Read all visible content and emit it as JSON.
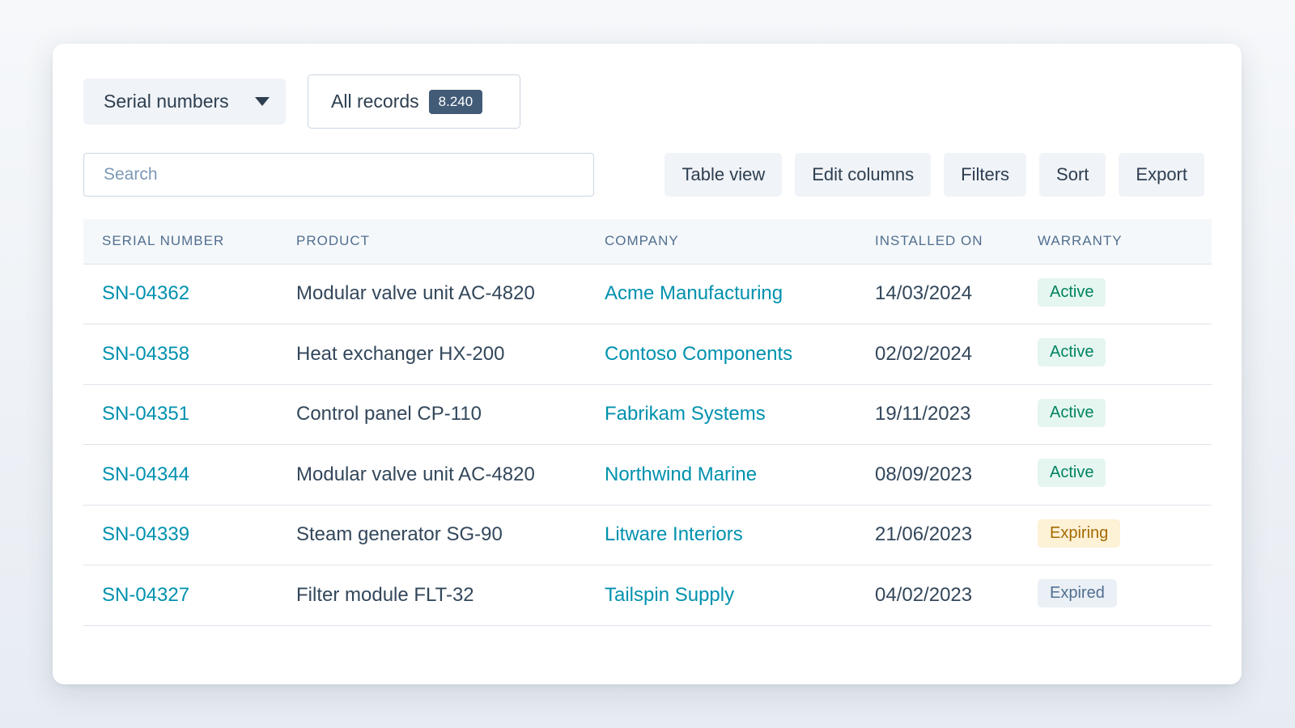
{
  "header": {
    "object_select": {
      "label": "Serial numbers"
    },
    "view_tab": {
      "label": "All records",
      "count": "8.240"
    }
  },
  "search": {
    "placeholder": "Search",
    "value": ""
  },
  "toolbar": {
    "table_view": "Table view",
    "edit_columns": "Edit columns",
    "filters": "Filters",
    "sort": "Sort",
    "export": "Export"
  },
  "table": {
    "columns": [
      "SERIAL NUMBER",
      "PRODUCT",
      "COMPANY",
      "INSTALLED ON",
      "WARRANTY"
    ],
    "rows": [
      {
        "serial": "SN-04362",
        "product": "Modular valve unit AC-4820",
        "company": "Acme Manufacturing",
        "installed": "14/03/2024",
        "warranty": "Active",
        "status": "active"
      },
      {
        "serial": "SN-04358",
        "product": "Heat exchanger HX-200",
        "company": "Contoso Components",
        "installed": "02/02/2024",
        "warranty": "Active",
        "status": "active"
      },
      {
        "serial": "SN-04351",
        "product": "Control panel CP-110",
        "company": "Fabrikam Systems",
        "installed": "19/11/2023",
        "warranty": "Active",
        "status": "active"
      },
      {
        "serial": "SN-04344",
        "product": "Modular valve unit AC-4820",
        "company": "Northwind Marine",
        "installed": "08/09/2023",
        "warranty": "Active",
        "status": "active"
      },
      {
        "serial": "SN-04339",
        "product": "Steam generator SG-90",
        "company": "Litware Interiors",
        "installed": "21/06/2023",
        "warranty": "Expiring",
        "status": "expiring"
      },
      {
        "serial": "SN-04327",
        "product": "Filter module FLT-32",
        "company": "Tailspin Supply",
        "installed": "04/02/2023",
        "warranty": "Expired",
        "status": "expired"
      }
    ]
  },
  "colors": {
    "link": "#0091ae",
    "text": "#33475b",
    "active_bg": "#e5f5f0",
    "active_fg": "#00835f",
    "expiring_bg": "#fdf1d6",
    "expiring_fg": "#a46a00",
    "expired_bg": "#eaf0f6",
    "expired_fg": "#516f90"
  },
  "icons": {
    "object_select_caret": "caret-down-icon"
  }
}
